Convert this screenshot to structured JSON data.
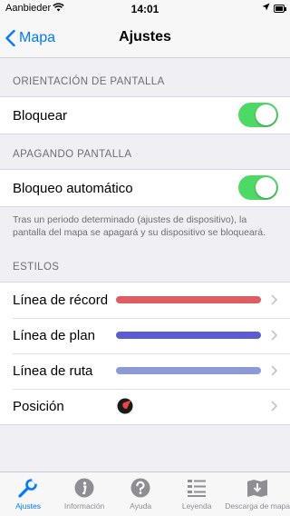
{
  "status_bar": {
    "carrier": "Aanbieder",
    "time": "14:01"
  },
  "nav": {
    "back_label": "Mapa",
    "title": "Ajustes"
  },
  "sections": {
    "orientation": {
      "header": "ORIENTACIÓN DE PANTALLA",
      "row_label": "Bloquear",
      "toggle_on": true
    },
    "screen_off": {
      "header": "APAGANDO PANTALLA",
      "row_label": "Bloqueo automático",
      "toggle_on": true,
      "footer": "Tras un periodo determinado (ajustes de dispositivo), la pantalla del mapa se apagará y su dispositivo se bloqueará."
    },
    "styles": {
      "header": "ESTILOS",
      "rows": [
        {
          "label": "Línea de récord",
          "color": "#e05c63"
        },
        {
          "label": "Línea de plan",
          "color": "#5b5bd6"
        },
        {
          "label": "Línea de ruta",
          "color": "#8c9ad8"
        },
        {
          "label": "Posición",
          "marker_color": "#e8483f"
        }
      ]
    }
  },
  "tab_bar": {
    "active_color": "#007aff",
    "tabs": [
      {
        "label": "Ajustes",
        "icon": "wrench-icon",
        "active": true
      },
      {
        "label": "Información",
        "icon": "info-icon",
        "active": false
      },
      {
        "label": "Ayuda",
        "icon": "help-icon",
        "active": false
      },
      {
        "label": "Leyenda",
        "icon": "legend-icon",
        "active": false
      },
      {
        "label": "Descarga de mapa",
        "icon": "download-map-icon",
        "active": false
      }
    ]
  }
}
